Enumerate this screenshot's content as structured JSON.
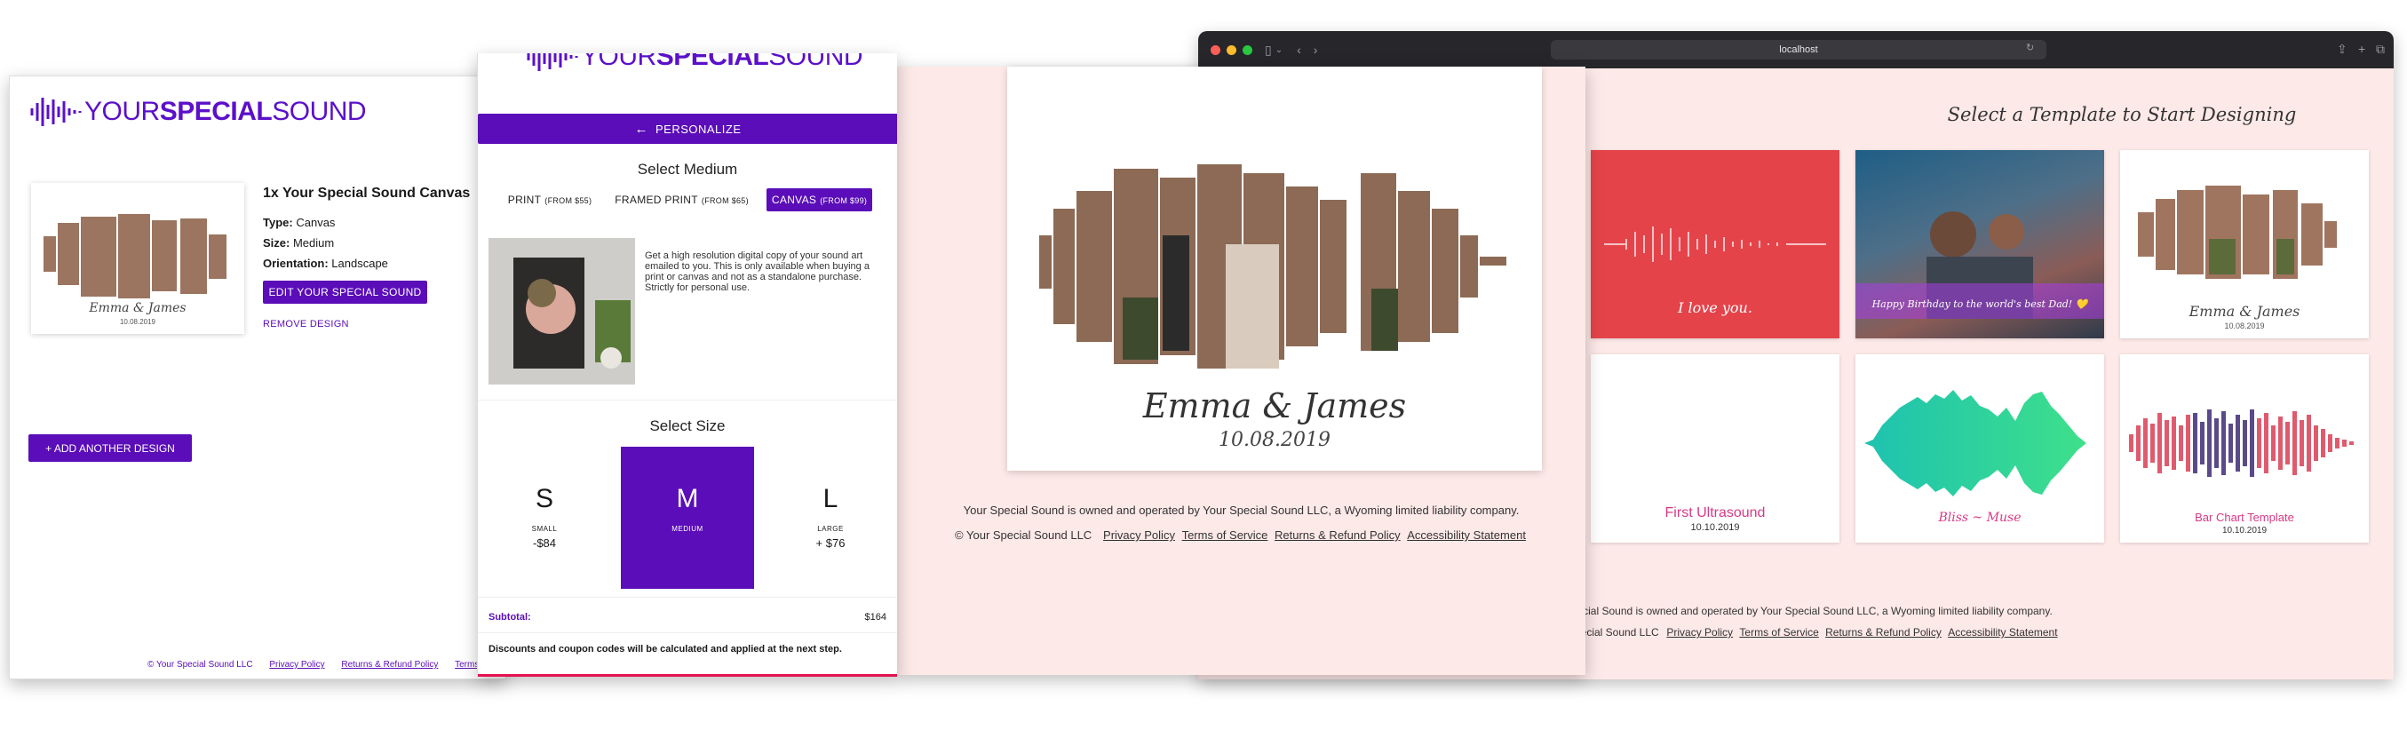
{
  "brand": {
    "logo_light": "YOUR",
    "logo_bold": "SPECIAL",
    "logo_end": "SOUND",
    "primary_color": "#5a0db8",
    "background_pink": "#fde9e8"
  },
  "browser": {
    "url": "localhost",
    "title": "Select a Template to Start Designing",
    "templates": [
      {
        "label": "I love you.",
        "color": "#e5434a"
      },
      {
        "label": "Happy Birthday to the world's best Dad! 💛",
        "color": "#5a6a7a"
      },
      {
        "label": "Emma & James",
        "sub": "10.08.2019"
      },
      {
        "label": "First Ultrasound",
        "sub": "10.10.2019"
      },
      {
        "label": "Bliss ~ Muse"
      },
      {
        "label": "Bar Chart Template",
        "sub": "10.10.2019"
      }
    ],
    "footer_line1": "Your Special Sound is owned and operated by Your Special Sound LLC, a Wyoming limited liability company.",
    "footer_copyright": "© Your Special Sound LLC",
    "footer_links": [
      "Privacy Policy",
      "Terms of Service",
      "Returns & Refund Policy",
      "Accessibility Statement"
    ]
  },
  "canvas_page": {
    "name": "Emma & James",
    "date": "10.08.2019",
    "footer_line1": "Your Special Sound is owned and operated by Your Special Sound LLC, a Wyoming limited liability company.",
    "footer_copyright": "© Your Special Sound LLC",
    "footer_links": [
      "Privacy Policy",
      "Terms of Service",
      "Returns & Refund Policy",
      "Accessibility Statement"
    ]
  },
  "cart": {
    "item_title": "1x Your Special Sound Canvas",
    "type_label": "Type:",
    "type_value": "Canvas",
    "size_label": "Size:",
    "size_value": "Medium",
    "orientation_label": "Orientation:",
    "orientation_value": "Landscape",
    "thumb_name": "Emma & James",
    "thumb_date": "10.08.2019",
    "edit_button": "EDIT YOUR SPECIAL SOUND",
    "remove_link": "REMOVE DESIGN",
    "add_button": "+ ADD ANOTHER DESIGN",
    "footer_copyright": "© Your Special Sound LLC",
    "footer_links": [
      "Privacy Policy",
      "Returns & Refund Policy",
      "Terms"
    ]
  },
  "personalize": {
    "button": "PERSONALIZE",
    "medium_title": "Select Medium",
    "mediums": [
      {
        "name": "PRINT",
        "price": "(FROM $55)"
      },
      {
        "name": "FRAMED PRINT",
        "price": "(FROM $65)"
      },
      {
        "name": "CANVAS",
        "price": "(FROM $99)"
      }
    ],
    "medium_desc": "Get a high resolution digital copy of your sound art emailed to you. This is only available when buying a print or canvas and not as a standalone purchase. Strictly for personal use.",
    "size_title": "Select Size",
    "sizes": [
      {
        "letter": "S",
        "name": "SMALL",
        "price": "-$84"
      },
      {
        "letter": "M",
        "name": "MEDIUM",
        "price": ""
      },
      {
        "letter": "L",
        "name": "LARGE",
        "price": "+ $76"
      }
    ],
    "subtotal_label": "Subtotal:",
    "subtotal_value": "$164",
    "discount_note": "Discounts and coupon codes will be calculated and applied at the next step."
  }
}
